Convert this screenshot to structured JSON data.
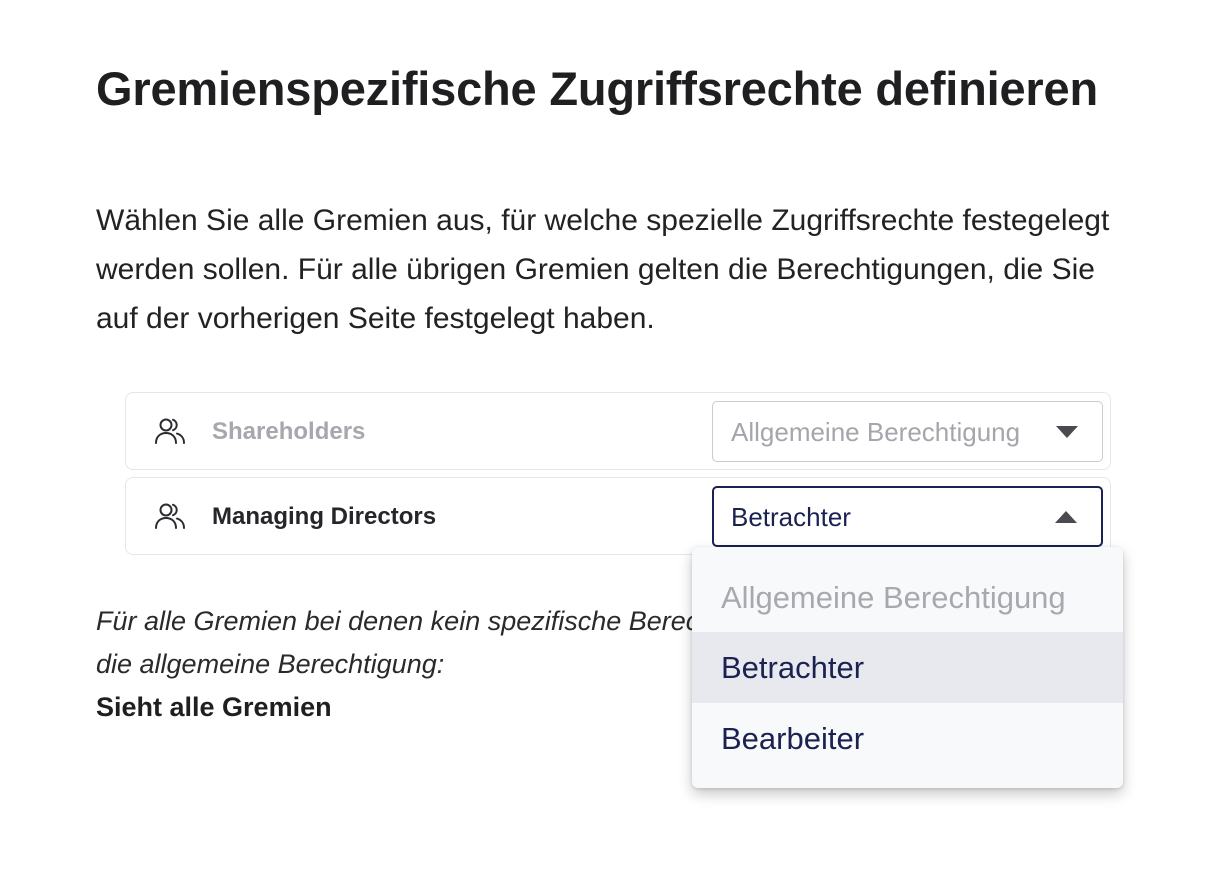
{
  "heading": {
    "title": "Gremienspezifische Zugriffsrechte definieren",
    "description": "Wählen Sie alle Gremien aus, für welche spezielle Zugriffsrechte festegelegt werden sollen. Für alle übrigen Gremien gelten die Berechtigungen, die Sie auf der vorherigen Seite festgelegt haben."
  },
  "committees": [
    {
      "label": "Shareholders",
      "icon": "users-icon",
      "permission": "Allgemeine Berechtigung",
      "state": "default"
    },
    {
      "label": "Managing Directors",
      "icon": "users-icon",
      "permission": "Betrachter",
      "state": "open"
    }
  ],
  "dropdown": {
    "options": [
      "Allgemeine Berechtigung",
      "Betrachter",
      "Bearbeiter"
    ],
    "selected": "Betrachter"
  },
  "footer": {
    "note": "Für alle Gremien bei denen kein spezifische Berechtigung gilt die allgemeine Berechtigung:",
    "general_permission": "Sieht alle Gremien"
  },
  "colors": {
    "text": "#1f1f21",
    "muted": "#a6a8ad",
    "accent_navy": "#1b2150",
    "option_hover": "#e8e9ee",
    "border": "#e5e6ea"
  }
}
